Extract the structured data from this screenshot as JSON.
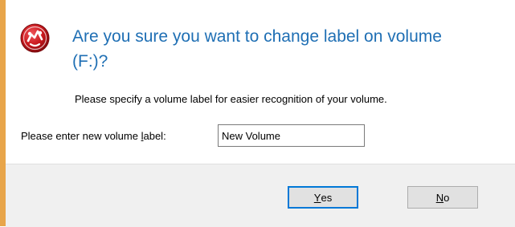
{
  "dialog": {
    "title": "Are you sure you want to change label on volume (F:)?",
    "description": "Please specify a volume label for easier recognition of your volume.",
    "field_label_prefix": "Please enter new volume ",
    "field_label_mnemonic": "l",
    "field_label_suffix": "abel:",
    "input_value": "New Volume",
    "icon": "volume-label-icon"
  },
  "buttons": {
    "yes_mnemonic": "Y",
    "yes_rest": "es",
    "no_mnemonic": "N",
    "no_rest": "o"
  },
  "colors": {
    "title": "#1f6fb4",
    "icon_red": "#c8171c",
    "frame_accent": "#e8a54a",
    "footer_bg": "#f0f0f0"
  }
}
